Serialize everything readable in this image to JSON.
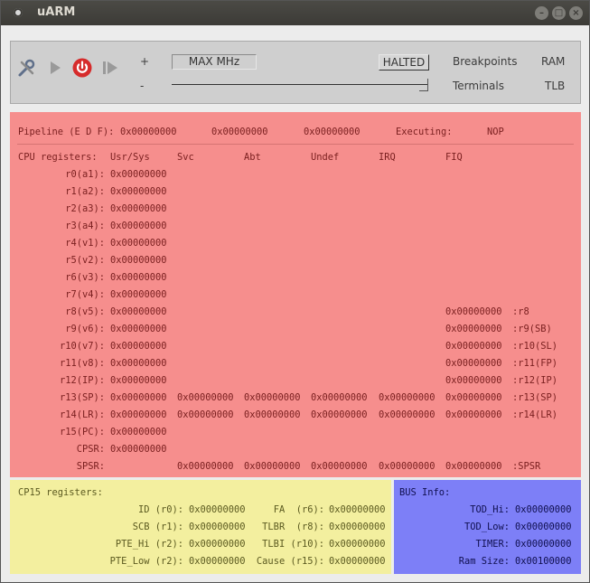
{
  "window": {
    "title": "uARM",
    "controls": [
      "–",
      "□",
      "×"
    ]
  },
  "toolbar": {
    "plus_label": "+",
    "minus_label": "-",
    "speed_label": "MAX MHz",
    "status_button": "HALTED",
    "breakpoints_label": "Breakpoints",
    "ram_label": "RAM",
    "terminals_label": "Terminals",
    "tlb_label": "TLB",
    "speed_level": 1.0,
    "icons": [
      "settings-icon",
      "play-icon",
      "power-icon",
      "step-forward-icon"
    ]
  },
  "cpu": {
    "pipeline_label": "Pipeline (E D F):",
    "pipeline": [
      "0x00000000",
      "0x00000000",
      "0x00000000"
    ],
    "executing_label": "Executing:",
    "executing": "NOP",
    "registers_label": "CPU registers:",
    "columns": [
      "Usr/Sys",
      "Svc",
      "Abt",
      "Undef",
      "IRQ",
      "FIQ"
    ],
    "rows": [
      {
        "name": "r0(a1):",
        "usr": "0x00000000",
        "svc": "",
        "abt": "",
        "und": "",
        "irq": "",
        "fiq": "",
        "fiq_name": ""
      },
      {
        "name": "r1(a2):",
        "usr": "0x00000000",
        "svc": "",
        "abt": "",
        "und": "",
        "irq": "",
        "fiq": "",
        "fiq_name": ""
      },
      {
        "name": "r2(a3):",
        "usr": "0x00000000",
        "svc": "",
        "abt": "",
        "und": "",
        "irq": "",
        "fiq": "",
        "fiq_name": ""
      },
      {
        "name": "r3(a4):",
        "usr": "0x00000000",
        "svc": "",
        "abt": "",
        "und": "",
        "irq": "",
        "fiq": "",
        "fiq_name": ""
      },
      {
        "name": "r4(v1):",
        "usr": "0x00000000",
        "svc": "",
        "abt": "",
        "und": "",
        "irq": "",
        "fiq": "",
        "fiq_name": ""
      },
      {
        "name": "r5(v2):",
        "usr": "0x00000000",
        "svc": "",
        "abt": "",
        "und": "",
        "irq": "",
        "fiq": "",
        "fiq_name": ""
      },
      {
        "name": "r6(v3):",
        "usr": "0x00000000",
        "svc": "",
        "abt": "",
        "und": "",
        "irq": "",
        "fiq": "",
        "fiq_name": ""
      },
      {
        "name": "r7(v4):",
        "usr": "0x00000000",
        "svc": "",
        "abt": "",
        "und": "",
        "irq": "",
        "fiq": "",
        "fiq_name": ""
      },
      {
        "name": "r8(v5):",
        "usr": "0x00000000",
        "svc": "",
        "abt": "",
        "und": "",
        "irq": "",
        "fiq": "0x00000000",
        "fiq_name": ":r8"
      },
      {
        "name": "r9(v6):",
        "usr": "0x00000000",
        "svc": "",
        "abt": "",
        "und": "",
        "irq": "",
        "fiq": "0x00000000",
        "fiq_name": ":r9(SB)"
      },
      {
        "name": "r10(v7):",
        "usr": "0x00000000",
        "svc": "",
        "abt": "",
        "und": "",
        "irq": "",
        "fiq": "0x00000000",
        "fiq_name": ":r10(SL)"
      },
      {
        "name": "r11(v8):",
        "usr": "0x00000000",
        "svc": "",
        "abt": "",
        "und": "",
        "irq": "",
        "fiq": "0x00000000",
        "fiq_name": ":r11(FP)"
      },
      {
        "name": "r12(IP):",
        "usr": "0x00000000",
        "svc": "",
        "abt": "",
        "und": "",
        "irq": "",
        "fiq": "0x00000000",
        "fiq_name": ":r12(IP)"
      },
      {
        "name": "r13(SP):",
        "usr": "0x00000000",
        "svc": "0x00000000",
        "abt": "0x00000000",
        "und": "0x00000000",
        "irq": "0x00000000",
        "fiq": "0x00000000",
        "fiq_name": ":r13(SP)"
      },
      {
        "name": "r14(LR):",
        "usr": "0x00000000",
        "svc": "0x00000000",
        "abt": "0x00000000",
        "und": "0x00000000",
        "irq": "0x00000000",
        "fiq": "0x00000000",
        "fiq_name": ":r14(LR)"
      },
      {
        "name": "r15(PC):",
        "usr": "0x00000000",
        "svc": "",
        "abt": "",
        "und": "",
        "irq": "",
        "fiq": "",
        "fiq_name": ""
      },
      {
        "name": "CPSR:",
        "usr": "0x00000000",
        "svc": "",
        "abt": "",
        "und": "",
        "irq": "",
        "fiq": "",
        "fiq_name": ""
      },
      {
        "name": "SPSR:",
        "usr": "",
        "svc": "0x00000000",
        "abt": "0x00000000",
        "und": "0x00000000",
        "irq": "0x00000000",
        "fiq": "0x00000000",
        "fiq_name": ":SPSR"
      }
    ]
  },
  "cp15": {
    "title": "CP15 registers:",
    "left": [
      {
        "label": "ID (r0):",
        "value": "0x00000000"
      },
      {
        "label": "SCB (r1):",
        "value": "0x00000000"
      },
      {
        "label": "PTE_Hi (r2):",
        "value": "0x00000000"
      },
      {
        "label": "PTE_Low (r2):",
        "value": "0x00000000"
      }
    ],
    "right": [
      {
        "label": "FA  (r6):",
        "value": "0x00000000"
      },
      {
        "label": "TLBR  (r8):",
        "value": "0x00000000"
      },
      {
        "label": "TLBI (r10):",
        "value": "0x00000000"
      },
      {
        "label": "Cause (r15):",
        "value": "0x00000000"
      }
    ]
  },
  "bus": {
    "title": "BUS Info:",
    "items": [
      {
        "label": "TOD_Hi:",
        "value": "0x00000000"
      },
      {
        "label": "TOD_Low:",
        "value": "0x00000000"
      },
      {
        "label": "TIMER:",
        "value": "0x00000000"
      },
      {
        "label": "Ram Size:",
        "value": "0x00100000"
      }
    ]
  },
  "colors": {
    "cpu_bg": "#f68e8d",
    "cp15_bg": "#f3ef9f",
    "bus_bg": "#7d7ff7",
    "power": "#d62b2b"
  }
}
